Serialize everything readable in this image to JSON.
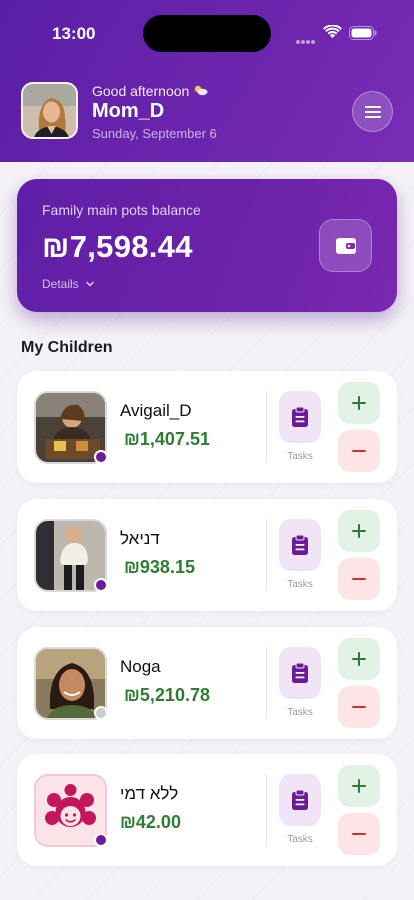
{
  "status_bar": {
    "time": "13:00"
  },
  "header": {
    "greeting": "Good afternoon",
    "username": "Mom_D",
    "date": "Sunday, September 6"
  },
  "balance_card": {
    "label": "Family main pots balance",
    "amount": "₪7,598.44",
    "details": "Details"
  },
  "section_title": "My Children",
  "tasks_label": "Tasks",
  "children": [
    {
      "name": "Avigail_D",
      "balance": "₪1,407.51",
      "status_color": "#6a1b9a"
    },
    {
      "name": "דניאל",
      "balance": "₪938.15",
      "status_color": "#6a1b9a"
    },
    {
      "name": "Noga",
      "balance": "₪5,210.78",
      "status_color": "#cccccc"
    },
    {
      "name": "ללא דמי",
      "balance": "₪42.00",
      "status_color": "#6a1b9a"
    }
  ],
  "colors": {
    "brand_purple": "#5a1fa6",
    "positive_green": "#2e7d32",
    "add_green": "#2e7d32",
    "subtract_red": "#d32f2f",
    "tasks_purple": "#6a1b9a"
  }
}
